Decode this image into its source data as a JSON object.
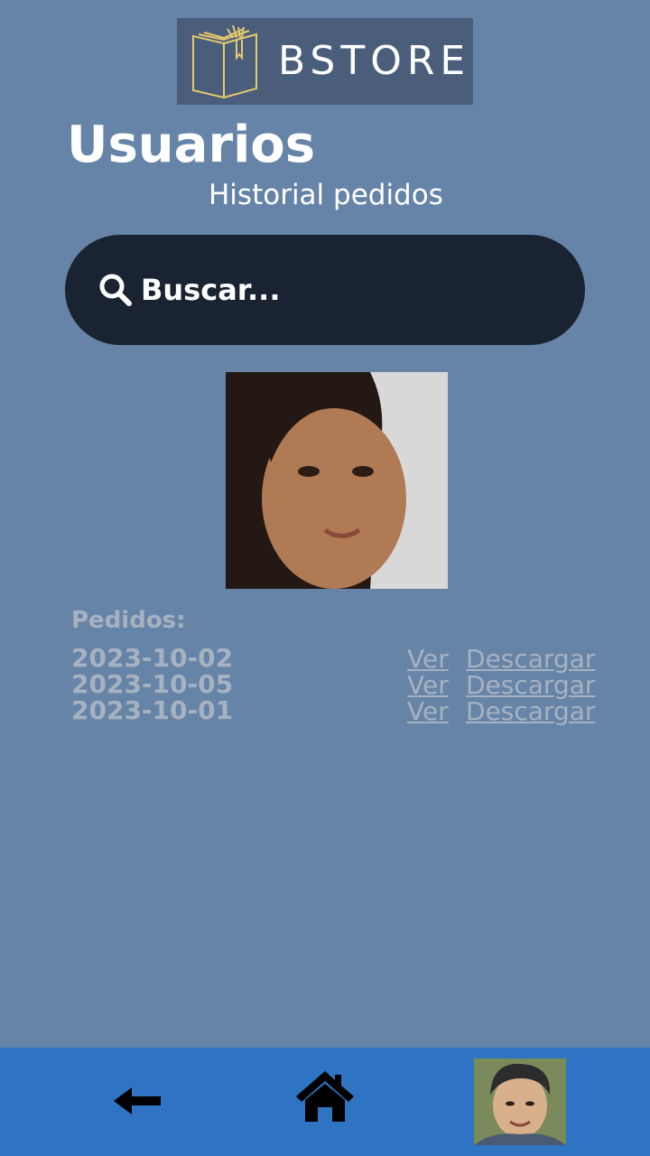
{
  "header": {
    "logo_text": "BSTORE",
    "title": "Usuarios",
    "subtitle": "Historial pedidos"
  },
  "search": {
    "placeholder": "Buscar...",
    "icon": "search-icon"
  },
  "orders": {
    "label": "Pedidos:",
    "items": [
      {
        "date": "2023-10-02",
        "view_label": "Ver",
        "download_label": "Descargar"
      },
      {
        "date": "2023-10-05",
        "view_label": "Ver",
        "download_label": "Descargar"
      },
      {
        "date": "2023-10-01",
        "view_label": "Ver",
        "download_label": "Descargar"
      }
    ]
  },
  "bottom_nav": {
    "back_icon": "arrow-left-icon",
    "home_icon": "home-icon",
    "profile_icon": "profile-avatar"
  },
  "colors": {
    "background": "#6684a8",
    "search_bg": "#1a2331",
    "nav_bg": "#2e74c3",
    "muted_text": "#a7b2c0",
    "logo_bg": "#4a5e7b",
    "logo_accent": "#e6c86e"
  }
}
